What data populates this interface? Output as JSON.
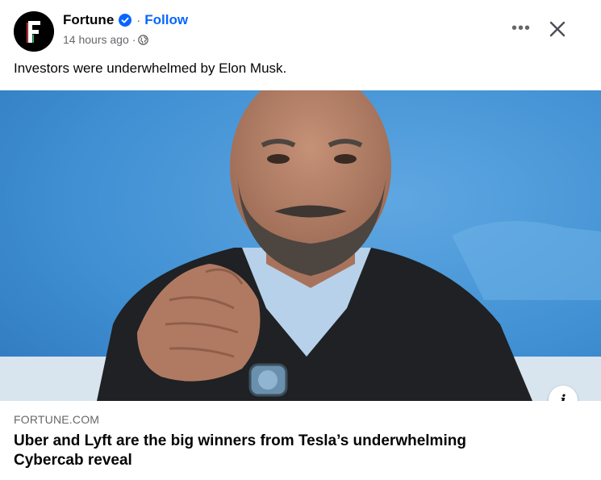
{
  "post": {
    "page_name": "Fortune",
    "separator": "·",
    "follow_label": "Follow",
    "timestamp": "14 hours ago",
    "time_separator": "·",
    "privacy_icon": "globe-icon",
    "verified_icon": "verified-badge-icon",
    "more_label": "•••",
    "caption": "Investors were underwhelmed by Elon Musk."
  },
  "link_preview": {
    "domain": "FORTUNE.COM",
    "title": "Uber and Lyft are the big winners from Tesla’s underwhelming Cybercab reveal",
    "info_label": "i"
  },
  "colors": {
    "text_primary": "#050505",
    "text_secondary": "#65676b",
    "accent": "#0866ff",
    "image_background": "#3f8fd2"
  }
}
